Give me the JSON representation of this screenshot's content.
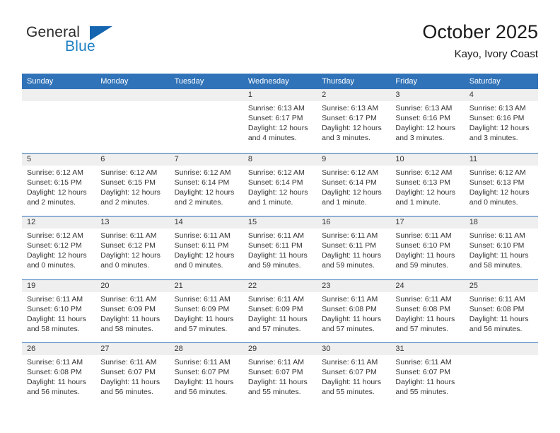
{
  "brand": {
    "line1": "General",
    "line2": "Blue",
    "triangle_color": "#1565b0",
    "blue_text_color": "#1f7fc4"
  },
  "header": {
    "title": "October 2025",
    "subtitle": "Kayo, Ivory Coast",
    "accent_color": "#3173b8",
    "daynum_band_color": "#efefef"
  },
  "weekdays": [
    "Sunday",
    "Monday",
    "Tuesday",
    "Wednesday",
    "Thursday",
    "Friday",
    "Saturday"
  ],
  "labels": {
    "sunrise": "Sunrise:",
    "sunset": "Sunset:",
    "daylight": "Daylight:"
  },
  "weeks": [
    [
      {
        "day": "",
        "sunrise": "",
        "sunset": "",
        "daylight": ""
      },
      {
        "day": "",
        "sunrise": "",
        "sunset": "",
        "daylight": ""
      },
      {
        "day": "",
        "sunrise": "",
        "sunset": "",
        "daylight": ""
      },
      {
        "day": "1",
        "sunrise": "Sunrise: 6:13 AM",
        "sunset": "Sunset: 6:17 PM",
        "daylight": "Daylight: 12 hours and 4 minutes."
      },
      {
        "day": "2",
        "sunrise": "Sunrise: 6:13 AM",
        "sunset": "Sunset: 6:17 PM",
        "daylight": "Daylight: 12 hours and 3 minutes."
      },
      {
        "day": "3",
        "sunrise": "Sunrise: 6:13 AM",
        "sunset": "Sunset: 6:16 PM",
        "daylight": "Daylight: 12 hours and 3 minutes."
      },
      {
        "day": "4",
        "sunrise": "Sunrise: 6:13 AM",
        "sunset": "Sunset: 6:16 PM",
        "daylight": "Daylight: 12 hours and 3 minutes."
      }
    ],
    [
      {
        "day": "5",
        "sunrise": "Sunrise: 6:12 AM",
        "sunset": "Sunset: 6:15 PM",
        "daylight": "Daylight: 12 hours and 2 minutes."
      },
      {
        "day": "6",
        "sunrise": "Sunrise: 6:12 AM",
        "sunset": "Sunset: 6:15 PM",
        "daylight": "Daylight: 12 hours and 2 minutes."
      },
      {
        "day": "7",
        "sunrise": "Sunrise: 6:12 AM",
        "sunset": "Sunset: 6:14 PM",
        "daylight": "Daylight: 12 hours and 2 minutes."
      },
      {
        "day": "8",
        "sunrise": "Sunrise: 6:12 AM",
        "sunset": "Sunset: 6:14 PM",
        "daylight": "Daylight: 12 hours and 1 minute."
      },
      {
        "day": "9",
        "sunrise": "Sunrise: 6:12 AM",
        "sunset": "Sunset: 6:14 PM",
        "daylight": "Daylight: 12 hours and 1 minute."
      },
      {
        "day": "10",
        "sunrise": "Sunrise: 6:12 AM",
        "sunset": "Sunset: 6:13 PM",
        "daylight": "Daylight: 12 hours and 1 minute."
      },
      {
        "day": "11",
        "sunrise": "Sunrise: 6:12 AM",
        "sunset": "Sunset: 6:13 PM",
        "daylight": "Daylight: 12 hours and 0 minutes."
      }
    ],
    [
      {
        "day": "12",
        "sunrise": "Sunrise: 6:12 AM",
        "sunset": "Sunset: 6:12 PM",
        "daylight": "Daylight: 12 hours and 0 minutes."
      },
      {
        "day": "13",
        "sunrise": "Sunrise: 6:11 AM",
        "sunset": "Sunset: 6:12 PM",
        "daylight": "Daylight: 12 hours and 0 minutes."
      },
      {
        "day": "14",
        "sunrise": "Sunrise: 6:11 AM",
        "sunset": "Sunset: 6:11 PM",
        "daylight": "Daylight: 12 hours and 0 minutes."
      },
      {
        "day": "15",
        "sunrise": "Sunrise: 6:11 AM",
        "sunset": "Sunset: 6:11 PM",
        "daylight": "Daylight: 11 hours and 59 minutes."
      },
      {
        "day": "16",
        "sunrise": "Sunrise: 6:11 AM",
        "sunset": "Sunset: 6:11 PM",
        "daylight": "Daylight: 11 hours and 59 minutes."
      },
      {
        "day": "17",
        "sunrise": "Sunrise: 6:11 AM",
        "sunset": "Sunset: 6:10 PM",
        "daylight": "Daylight: 11 hours and 59 minutes."
      },
      {
        "day": "18",
        "sunrise": "Sunrise: 6:11 AM",
        "sunset": "Sunset: 6:10 PM",
        "daylight": "Daylight: 11 hours and 58 minutes."
      }
    ],
    [
      {
        "day": "19",
        "sunrise": "Sunrise: 6:11 AM",
        "sunset": "Sunset: 6:10 PM",
        "daylight": "Daylight: 11 hours and 58 minutes."
      },
      {
        "day": "20",
        "sunrise": "Sunrise: 6:11 AM",
        "sunset": "Sunset: 6:09 PM",
        "daylight": "Daylight: 11 hours and 58 minutes."
      },
      {
        "day": "21",
        "sunrise": "Sunrise: 6:11 AM",
        "sunset": "Sunset: 6:09 PM",
        "daylight": "Daylight: 11 hours and 57 minutes."
      },
      {
        "day": "22",
        "sunrise": "Sunrise: 6:11 AM",
        "sunset": "Sunset: 6:09 PM",
        "daylight": "Daylight: 11 hours and 57 minutes."
      },
      {
        "day": "23",
        "sunrise": "Sunrise: 6:11 AM",
        "sunset": "Sunset: 6:08 PM",
        "daylight": "Daylight: 11 hours and 57 minutes."
      },
      {
        "day": "24",
        "sunrise": "Sunrise: 6:11 AM",
        "sunset": "Sunset: 6:08 PM",
        "daylight": "Daylight: 11 hours and 57 minutes."
      },
      {
        "day": "25",
        "sunrise": "Sunrise: 6:11 AM",
        "sunset": "Sunset: 6:08 PM",
        "daylight": "Daylight: 11 hours and 56 minutes."
      }
    ],
    [
      {
        "day": "26",
        "sunrise": "Sunrise: 6:11 AM",
        "sunset": "Sunset: 6:08 PM",
        "daylight": "Daylight: 11 hours and 56 minutes."
      },
      {
        "day": "27",
        "sunrise": "Sunrise: 6:11 AM",
        "sunset": "Sunset: 6:07 PM",
        "daylight": "Daylight: 11 hours and 56 minutes."
      },
      {
        "day": "28",
        "sunrise": "Sunrise: 6:11 AM",
        "sunset": "Sunset: 6:07 PM",
        "daylight": "Daylight: 11 hours and 56 minutes."
      },
      {
        "day": "29",
        "sunrise": "Sunrise: 6:11 AM",
        "sunset": "Sunset: 6:07 PM",
        "daylight": "Daylight: 11 hours and 55 minutes."
      },
      {
        "day": "30",
        "sunrise": "Sunrise: 6:11 AM",
        "sunset": "Sunset: 6:07 PM",
        "daylight": "Daylight: 11 hours and 55 minutes."
      },
      {
        "day": "31",
        "sunrise": "Sunrise: 6:11 AM",
        "sunset": "Sunset: 6:07 PM",
        "daylight": "Daylight: 11 hours and 55 minutes."
      },
      {
        "day": "",
        "sunrise": "",
        "sunset": "",
        "daylight": ""
      }
    ]
  ]
}
